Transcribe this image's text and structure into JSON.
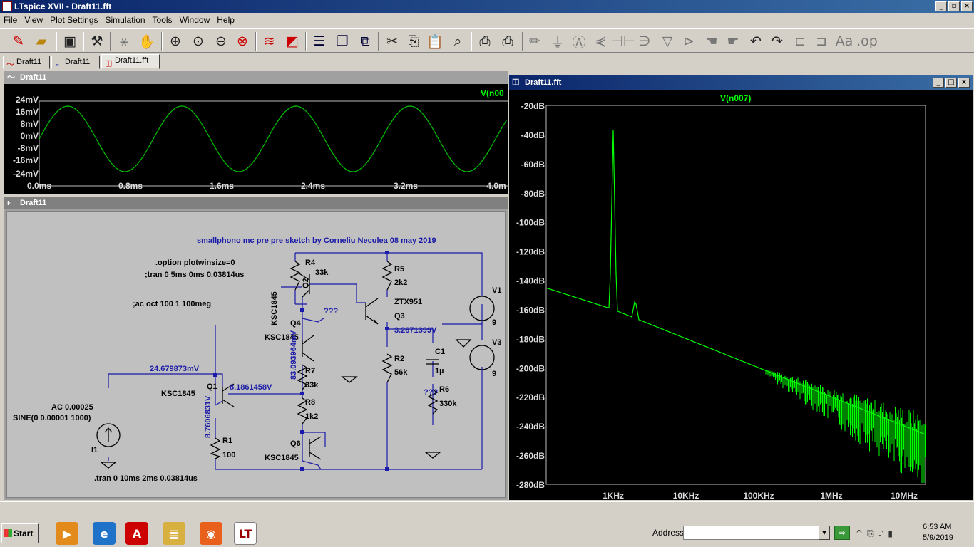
{
  "app": {
    "title": "LTspice XVII - Draft11.fft"
  },
  "menu": [
    "File",
    "View",
    "Plot Settings",
    "Simulation",
    "Tools",
    "Window",
    "Help"
  ],
  "toolbar_icons": [
    "new-schematic",
    "open",
    "save",
    "control-panel",
    "run",
    "halt",
    "zoom-in",
    "pan",
    "zoom-out",
    "zoom-fit",
    "autorange",
    "waveform-settings",
    "tile-horizontal",
    "cascade",
    "tile-vertical",
    "cut",
    "copy",
    "paste",
    "find",
    "print-setup",
    "print",
    "wire",
    "ground",
    "label",
    "component",
    "capacitor",
    "inductor",
    "diode",
    "resistor",
    "move",
    "drag",
    "undo",
    "redo",
    "rotate",
    "mirror",
    "text",
    "spice-directive"
  ],
  "tabs": [
    {
      "label": "Draft11",
      "icon": "waveform-icon"
    },
    {
      "label": "Draft11",
      "icon": "schematic-icon"
    },
    {
      "label": "Draft11.fft",
      "icon": "fft-icon"
    }
  ],
  "wave": {
    "title": "Draft11",
    "trace_label": "V(n00",
    "y_ticks": [
      "24mV",
      "16mV",
      "8mV",
      "0mV",
      "-8mV",
      "-16mV",
      "-24mV"
    ],
    "x_ticks": [
      "0.0ms",
      "0.8ms",
      "1.6ms",
      "2.4ms",
      "3.2ms",
      "4.0m"
    ],
    "color": "#00c000"
  },
  "chart_data": {
    "type": "line",
    "trace": "V(n007)",
    "x_ticks": [
      "1KHz",
      "10KHz",
      "100KHz",
      "1MHz",
      "10MHz"
    ],
    "y_ticks": [
      "-20dB",
      "-40dB",
      "-60dB",
      "-80dB",
      "-100dB",
      "-120dB",
      "-140dB",
      "-160dB",
      "-180dB",
      "-200dB",
      "-220dB",
      "-240dB",
      "-260dB",
      "-280dB"
    ],
    "x_scale": "log",
    "ylim": [
      -280,
      -20
    ],
    "grid": false,
    "line_color": "#00ff00",
    "floor": {
      "x": [
        100,
        1000,
        10000,
        100000,
        1000000,
        20000000
      ],
      "y": [
        -144,
        -160,
        -180,
        -200,
        -220,
        -246
      ]
    },
    "peaks": [
      {
        "x": 1000,
        "y": -37
      },
      {
        "x": 2000,
        "y": -153
      }
    ]
  },
  "fft": {
    "title": "Draft11.fft"
  },
  "schematic": {
    "title": "Draft11",
    "header": "smallphono mc pre pre  sketch by Corneliu Neculea  08 may 2019",
    "directives": [
      ".option plotwinsize=0",
      ";tran 0 5ms 0ms 0.03814us",
      ";ac oct 100 1 100meg",
      ".tran 0 10ms 2ms 0.03814us"
    ],
    "source": [
      "AC 0.00025",
      "SINE(0 0.00001 1000)",
      "I1"
    ],
    "components": {
      "R4": "R4",
      "R4v": "33k",
      "R5": "R5",
      "R5v": "2k2",
      "Q2": "Q2",
      "Q2m": "KSC1845",
      "ZTX": "ZTX951",
      "Q3": "Q3",
      "V1": "V1",
      "V1v": "9",
      "V3": "V3",
      "V3v": "9",
      "Q4": "Q4",
      "Q4m": "KSC1845",
      "R2": "R2",
      "R2v": "56k",
      "C1": "C1",
      "C1v": "1µ",
      "R7": "R7",
      "R7v": "33k",
      "Q1": "Q1",
      "Q1m": "KSC1845",
      "R6": "R6",
      "R6v": "330k",
      "R8": "R8",
      "R8v": "1k2",
      "R1": "R1",
      "R1v": "100",
      "Q6": "Q6",
      "Q6m": "KSC1845"
    },
    "voltages": {
      "v1": "24.679873mV",
      "v2": "3.2671399V",
      "v3": "8.1861458V",
      "v4": "83.093964mV",
      "v5": "8.7606831V",
      "q1": "???",
      "q2": "???"
    }
  },
  "taskbar": {
    "start": "Start",
    "address_label": "Address",
    "address_value": "",
    "time": "6:53 AM",
    "date": "5/9/2019"
  }
}
